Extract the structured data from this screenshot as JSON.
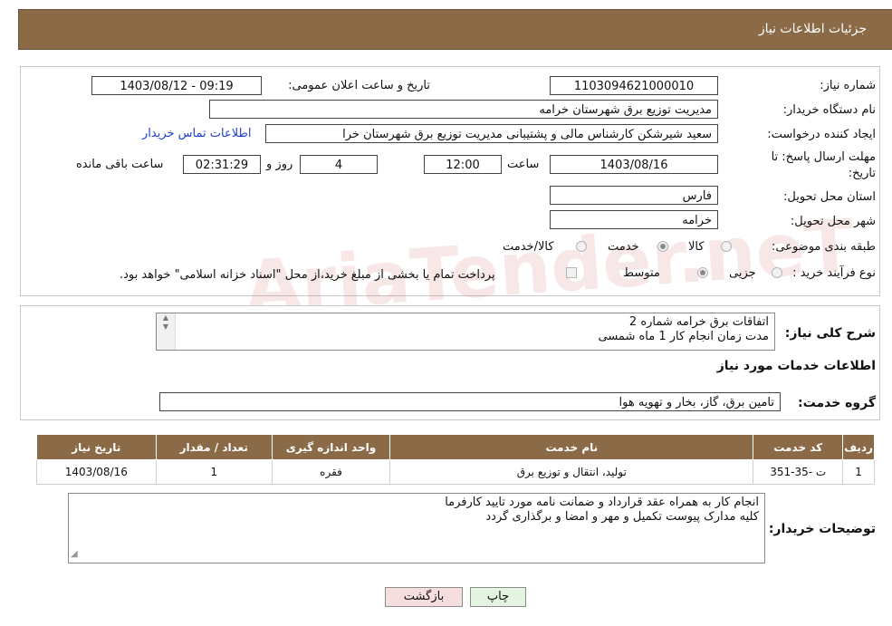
{
  "header": {
    "title": "جزئیات اطلاعات نیاز"
  },
  "form": {
    "need_number_label": "شماره نیاز:",
    "need_number": "1103094621000010",
    "announce_label": "تاریخ و ساعت اعلان عمومی:",
    "announce_value": "1403/08/12 - 09:19",
    "buyer_org_label": "نام دستگاه خریدار:",
    "buyer_org": "مدیریت توزیع برق شهرستان خرامه",
    "creator_label": "ایجاد کننده درخواست:",
    "creator": "سعید  شیرشکن  کارشناس مالی و پشتیبانی  مدیریت توزیع برق شهرستان خرا",
    "contact_link": "اطلاعات تماس خریدار",
    "deadline_label_1": "مهلت ارسال پاسخ: تا",
    "deadline_label_2": "تاریخ:",
    "deadline_date": "1403/08/16",
    "time_label": "ساعت",
    "deadline_time": "12:00",
    "days_value": "4",
    "days_label": "روز و",
    "remaining_time": "02:31:29",
    "remaining_label": "ساعت باقی مانده",
    "province_label": "استان محل تحویل:",
    "province": "فارس",
    "city_label": "شهر محل تحویل:",
    "city": "خرامه",
    "category_label": "طبقه بندی موضوعی:",
    "category_options": [
      "کالا",
      "خدمت",
      "کالا/خدمت"
    ],
    "category_selected": "خدمت",
    "process_label": "نوع فرآیند خرید :",
    "process_options": [
      "جزیی",
      "متوسط"
    ],
    "process_selected": "متوسط",
    "payment_note": "پرداخت تمام یا بخشی از مبلغ خرید،از محل \"اسناد خزانه اسلامی\" خواهد بود."
  },
  "description": {
    "label": "شرح کلی نیاز:",
    "line1": "اتفاقات برق خرامه شماره 2",
    "line2": "مدت زمان انجام کار 1 ماه شمسی"
  },
  "services": {
    "section_title": "اطلاعات خدمات مورد نیاز",
    "group_label": "گروه خدمت:",
    "group_value": "تامین برق، گاز، بخار و تهویه هوا",
    "table": {
      "headers": [
        "ردیف",
        "کد خدمت",
        "نام خدمت",
        "واحد اندازه گیری",
        "تعداد / مقدار",
        "تاریخ نیاز"
      ],
      "rows": [
        [
          "1",
          "ت -35-351",
          "تولید، انتقال و توزیع برق",
          "فقره",
          "1",
          "1403/08/16"
        ]
      ]
    }
  },
  "buyer_notes": {
    "label": "توضیحات خریدار:",
    "line1": "انجام کار به همراه عقد قرارداد و ضمانت نامه مورد تایید کارفرما",
    "line2": "کلیه مدارک پیوست تکمیل و مهر و امضا و برگذاری گردد"
  },
  "buttons": {
    "print": "چاپ",
    "back": "بازگشت"
  },
  "watermark": "AriaTender.neT",
  "colors": {
    "header": "#8b6a47",
    "link": "#1d3fcf",
    "back_button": "#f7dede",
    "print_button": "#e3f4e0"
  }
}
